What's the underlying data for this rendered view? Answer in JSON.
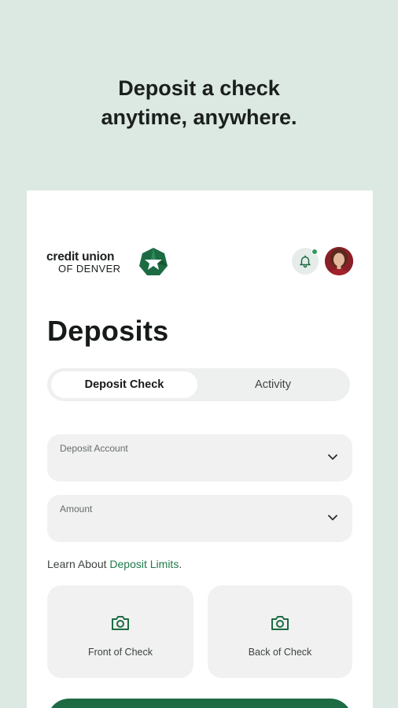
{
  "promo": {
    "headline_line1": "Deposit a check",
    "headline_line2": "anytime, anywhere."
  },
  "header": {
    "logo_line1": "credit union",
    "logo_line2": "OF DENVER",
    "notification_indicator": true
  },
  "page": {
    "title": "Deposits"
  },
  "tabs": [
    {
      "label": "Deposit Check",
      "active": true
    },
    {
      "label": "Activity",
      "active": false
    }
  ],
  "form": {
    "deposit_account": {
      "label": "Deposit Account",
      "value": ""
    },
    "amount": {
      "label": "Amount",
      "value": ""
    }
  },
  "limits": {
    "prefix": "Learn About ",
    "link": "Deposit Limits",
    "suffix": "."
  },
  "check_capture": {
    "front_label": "Front of Check",
    "back_label": "Back of Check"
  },
  "colors": {
    "background": "#dce8e2",
    "brand_green": "#1c6b43",
    "link_green": "#1f7a4a",
    "field_bg": "#f0f1f0"
  },
  "icons": {
    "notification": "bell-icon",
    "field_dropdown": "chevron-down-icon",
    "capture": "camera-icon"
  }
}
